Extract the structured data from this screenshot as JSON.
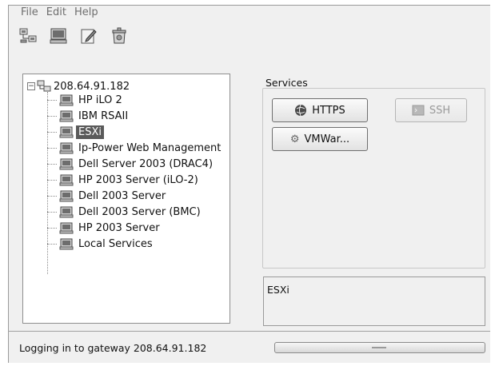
{
  "menu": [
    "File",
    "Edit",
    "Help"
  ],
  "toolbar": {
    "buttons": [
      {
        "icon": "network-icon"
      },
      {
        "icon": "computer-icon"
      },
      {
        "icon": "edit-icon"
      },
      {
        "icon": "trash-icon"
      }
    ]
  },
  "tree": {
    "root": "208.64.91.182",
    "items": [
      {
        "label": "HP iLO 2",
        "selected": false
      },
      {
        "label": "IBM RSAII",
        "selected": false
      },
      {
        "label": "ESXi",
        "selected": true
      },
      {
        "label": "Ip-Power Web Management",
        "selected": false
      },
      {
        "label": "Dell Server 2003 (DRAC4)",
        "selected": false
      },
      {
        "label": "HP 2003 Server (iLO-2)",
        "selected": false
      },
      {
        "label": "Dell 2003 Server",
        "selected": false
      },
      {
        "label": "Dell 2003 Server (BMC)",
        "selected": false
      },
      {
        "label": "HP 2003 Server",
        "selected": false
      },
      {
        "label": "Local Services",
        "selected": false
      }
    ]
  },
  "services": {
    "label": "Services",
    "https": "HTTPS",
    "ssh": "SSH",
    "vmware": "VMWar..."
  },
  "description": "ESXi",
  "status": {
    "text": "Logging in to gateway 208.64.91.182"
  }
}
